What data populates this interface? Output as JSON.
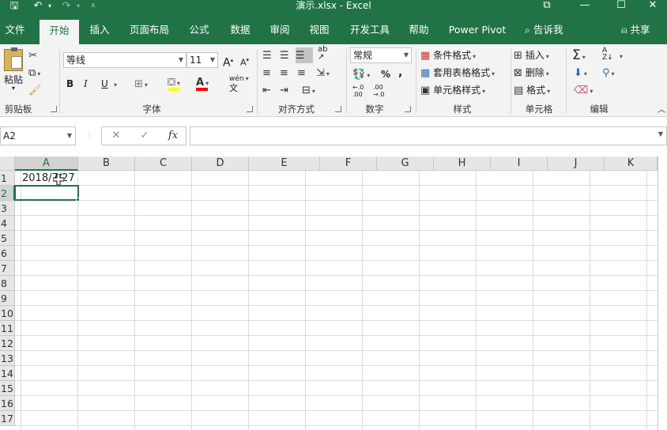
{
  "window": {
    "title": "演示.xlsx  -  Excel",
    "controls": [
      "⧉",
      "—",
      "☐",
      "✕"
    ]
  },
  "quick_access": {
    "save": "🖫",
    "undo": "↶",
    "redo": "↷",
    "customize": "⩡"
  },
  "tabs": [
    "文件",
    "开始",
    "插入",
    "页面布局",
    "公式",
    "数据",
    "审阅",
    "视图",
    "开发工具",
    "帮助",
    "Power Pivot"
  ],
  "active_tab": "开始",
  "tell_me": "告诉我",
  "share": "共享",
  "ribbon": {
    "clipboard": {
      "label": "剪贴板",
      "paste": "粘贴"
    },
    "font": {
      "label": "字体",
      "font_name": "等线",
      "font_size": "11",
      "grow": "A",
      "shrink": "A",
      "bold": "B",
      "italic": "I",
      "underline": "U",
      "phonetic": "wén"
    },
    "alignment": {
      "label": "对齐方式"
    },
    "number": {
      "label": "数字",
      "format": "常规",
      "percent": "%",
      "comma": ","
    },
    "styles": {
      "label": "样式",
      "conditional": "条件格式",
      "table": "套用表格格式",
      "cell_styles": "单元格样式"
    },
    "cells": {
      "label": "单元格",
      "insert": "插入",
      "delete": "删除",
      "format": "格式"
    },
    "editing": {
      "label": "编辑"
    }
  },
  "formula_bar": {
    "name_box": "A2",
    "cancel": "✕",
    "enter": "✓",
    "fx": "fx",
    "value": ""
  },
  "columns": [
    "A",
    "B",
    "C",
    "D",
    "E",
    "F",
    "G",
    "H",
    "I",
    "J",
    "K"
  ],
  "rows": [
    "1",
    "2",
    "3",
    "4",
    "5",
    "6",
    "7",
    "8",
    "9",
    "10",
    "11",
    "12",
    "13",
    "14",
    "15",
    "16",
    "17"
  ],
  "cells": {
    "A1": "2018/7/27"
  },
  "colors": {
    "accent": "#217346",
    "ribbon_bg": "#f3f3f3",
    "grid_line": "#dadada"
  }
}
